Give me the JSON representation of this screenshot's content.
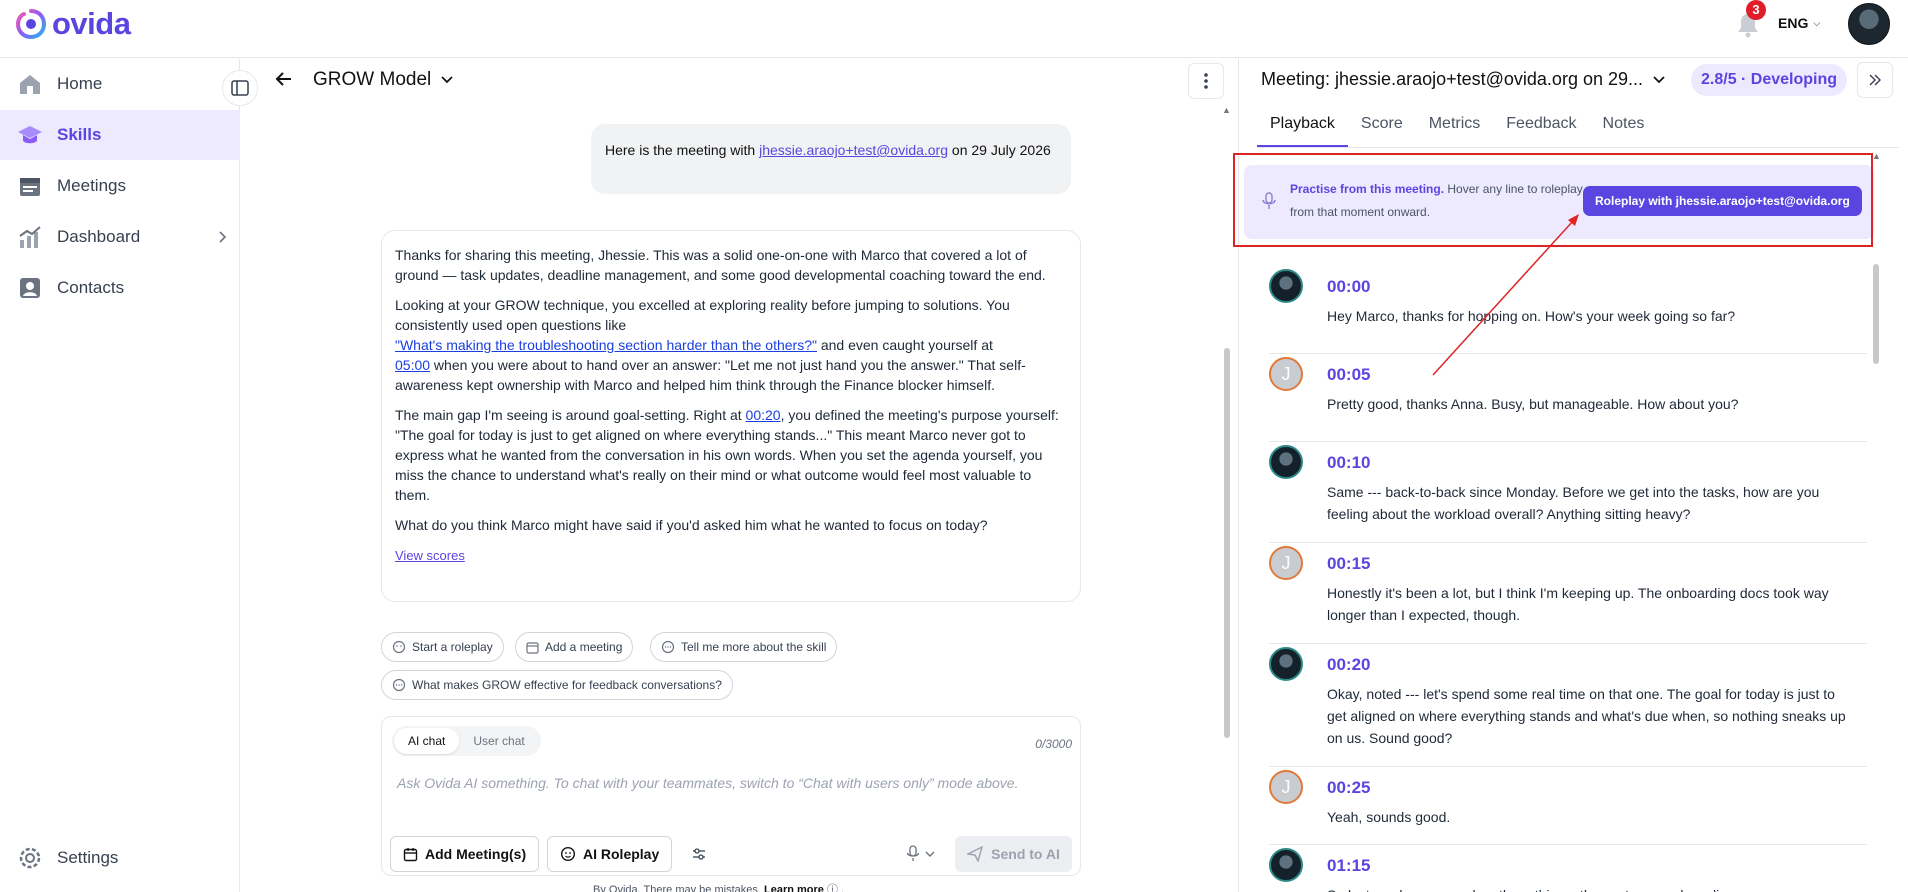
{
  "brand": {
    "name": "ovida",
    "color": "#5b45e0"
  },
  "topbar": {
    "notification_count": "3",
    "language": "ENG"
  },
  "sidebar": {
    "items": [
      {
        "label": "Home",
        "icon": "home-icon"
      },
      {
        "label": "Skills",
        "icon": "graduation-cap-icon",
        "active": true
      },
      {
        "label": "Meetings",
        "icon": "calendar-icon"
      },
      {
        "label": "Dashboard",
        "icon": "chart-icon"
      },
      {
        "label": "Contacts",
        "icon": "contact-icon"
      }
    ],
    "settings_label": "Settings"
  },
  "center": {
    "title": "GROW Model",
    "user_message": {
      "prefix": "Here is the meeting with ",
      "link": "jhessie.araojo+test@ovida.org",
      "suffix": " on 29 July 2026"
    },
    "ai_message": {
      "p1": "Thanks for sharing this meeting, Jhessie. This was a solid one-on-one with Marco that covered a lot of ground — task updates, deadline management, and some good developmental coaching toward the end.",
      "p2a": "Looking at your GROW technique, you excelled at exploring reality before jumping to solutions. You consistently used open questions like ",
      "p2_link1": "\"What's making the troubleshooting section harder than the others?\"",
      "p2b": " and even caught yourself at ",
      "p2_link2": "05:00",
      "p2c": " when you were about to hand over an answer: \"Let me not just hand you the answer.\" That self-awareness kept ownership with Marco and helped him think through the Finance blocker himself.",
      "p3a": "The main gap I'm seeing is around goal-setting. Right at ",
      "p3_link": "00:20",
      "p3b": ", you defined the meeting's purpose yourself: \"The goal for today is just to get aligned on where everything stands...\" This meant Marco never got to express what he wanted from the conversation in his own words. When you set the agenda yourself, you miss the chance to understand what's really on their mind or what outcome would feel most valuable to them.",
      "p4": "What do you think Marco might have said if you'd asked him what he wanted to focus on today?",
      "view_scores": "View scores"
    },
    "chips": [
      "Start a roleplay",
      "Add a meeting",
      "Tell me more about the skill",
      "What makes GROW effective for feedback conversations?"
    ],
    "composer": {
      "mode_ai": "AI chat",
      "mode_user": "User chat",
      "counter": "0/3000",
      "placeholder": "Ask Ovida AI something. To chat with your teammates, switch to “Chat with users only” mode above.",
      "add_meetings": "Add Meeting(s)",
      "ai_roleplay": "AI Roleplay",
      "send": "Send to AI"
    },
    "disclaimer": {
      "text": "By Ovida. There may be mistakes. ",
      "link": "Learn more"
    }
  },
  "right_panel": {
    "title": "Meeting: jhessie.araojo+test@ovida.org on 29...",
    "score": "2.8/5 · Developing",
    "tabs": [
      "Playback",
      "Score",
      "Metrics",
      "Feedback",
      "Notes"
    ],
    "active_tab": "Playback",
    "banner": {
      "bold": "Practise from this meeting.",
      "text": " Hover any line to roleplay from that moment onward.",
      "button": "Roleplay with jhessie.araojo+test@ovida.org"
    },
    "transcript": [
      {
        "speaker": "marco",
        "time": "00:00",
        "text": "Hey Marco, thanks for hopping on. How's your week going so far?"
      },
      {
        "speaker": "j",
        "time": "00:05",
        "text": "Pretty good, thanks Anna. Busy, but manageable. How about you?"
      },
      {
        "speaker": "marco",
        "time": "00:10",
        "text": "Same --- back-to-back since Monday. Before we get into the tasks, how are you feeling about the workload overall? Anything sitting heavy?"
      },
      {
        "speaker": "j",
        "time": "00:15",
        "text": "Honestly it's been a lot, but I think I'm keeping up. The onboarding docs took way longer than I expected, though."
      },
      {
        "speaker": "marco",
        "time": "00:20",
        "text": "Okay, noted --- let's spend some real time on that one. The goal for today is just to get aligned on where everything stands and what's due when, so nothing sneaks up on us. Sound good?"
      },
      {
        "speaker": "j",
        "time": "00:25",
        "text": "Yeah, sounds good."
      },
      {
        "speaker": "marco",
        "time": "01:15",
        "text": "So last week we agreed on three things: the customer onboarding"
      }
    ],
    "avatar_initial": "J"
  }
}
